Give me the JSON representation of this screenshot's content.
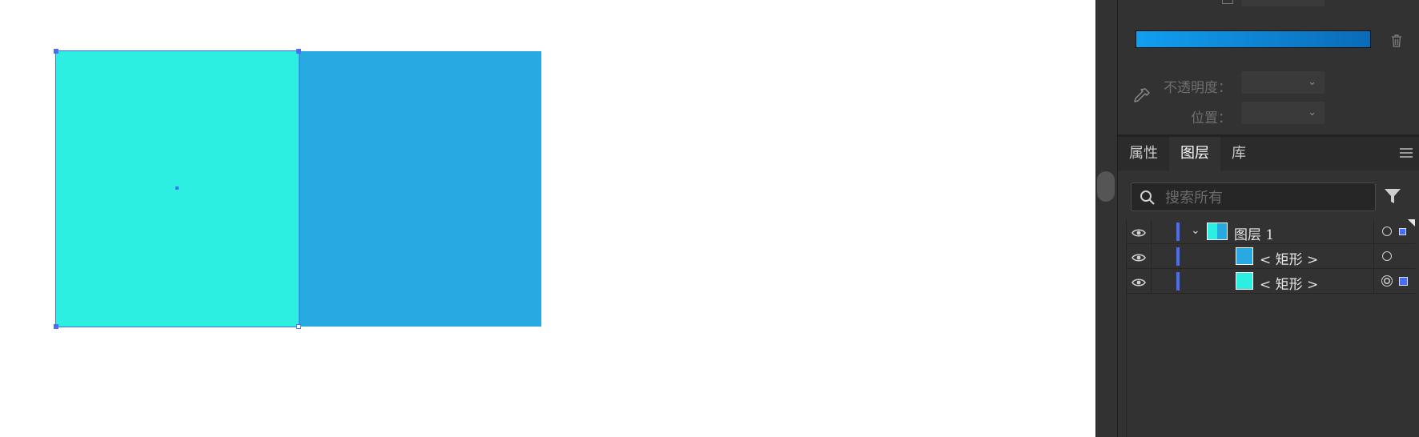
{
  "canvas": {
    "rects": [
      {
        "name": "rect-back",
        "color": "#29a9e1"
      },
      {
        "name": "rect-front-selected",
        "color": "#2cefe1"
      }
    ],
    "selection_color": "#4a6cf7"
  },
  "gradient_panel": {
    "gradient_colors": [
      "#119ff0",
      "#0a6bb8"
    ],
    "opacity_label": "不透明度：",
    "opacity_value": "",
    "position_label": "位置：",
    "position_value": "",
    "icons": [
      "eyedropper-icon",
      "trash-icon",
      "chevron-down-icon"
    ]
  },
  "tabs": [
    {
      "label": "属性",
      "active": false
    },
    {
      "label": "图层",
      "active": true
    },
    {
      "label": "库",
      "active": false
    }
  ],
  "layers_panel": {
    "search_placeholder": "搜索所有",
    "layers": [
      {
        "name": "图层 1",
        "expanded": true,
        "thumb": [
          "#2cefe1",
          "#29a9e1"
        ],
        "selected": true
      },
      {
        "name": "< 矩形 >",
        "thumb": [
          "#29a9e1"
        ],
        "selected": false
      },
      {
        "name": "< 矩形 >",
        "thumb": [
          "#2cefe1"
        ],
        "selected": true
      }
    ]
  }
}
